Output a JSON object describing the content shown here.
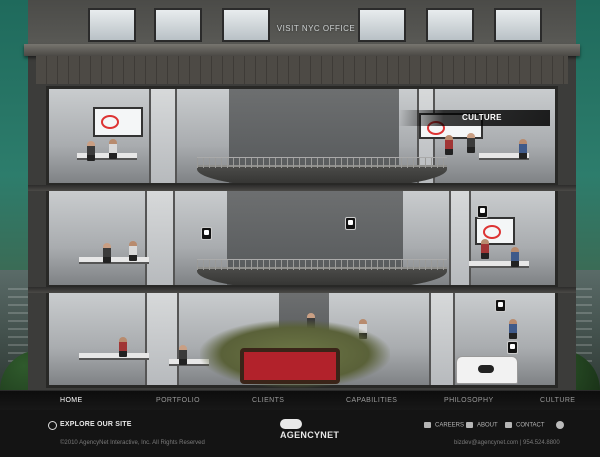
{
  "building": {
    "visit_label": "VISIT NYC OFFICE",
    "culture_tooltip": "CULTURE"
  },
  "nav": {
    "items": [
      {
        "label": "HOME",
        "active": true
      },
      {
        "label": "PORTFOLIO",
        "active": false
      },
      {
        "label": "CLIENTS",
        "active": false
      },
      {
        "label": "CAPABILITIES",
        "active": false
      },
      {
        "label": "PHILOSOPHY",
        "active": false
      },
      {
        "label": "CULTURE",
        "active": false
      }
    ]
  },
  "footer": {
    "explore_label": "EXPLORE OUR SITE",
    "logo_text": "AGENCYNET",
    "copyright": "©2010 AgencyNet Interactive, Inc. All Rights Reserved",
    "careers_label": "CAREERS",
    "about_label": "ABOUT",
    "contact_label": "CONTACT",
    "contact_line": "bizdev@agencynet.com  |  954.524.8800"
  },
  "colors": {
    "sky": "#2d7d6c",
    "pool_table": "#b2222b",
    "nav_active": "#ffffff",
    "nav_inactive": "#9a9a9a"
  }
}
